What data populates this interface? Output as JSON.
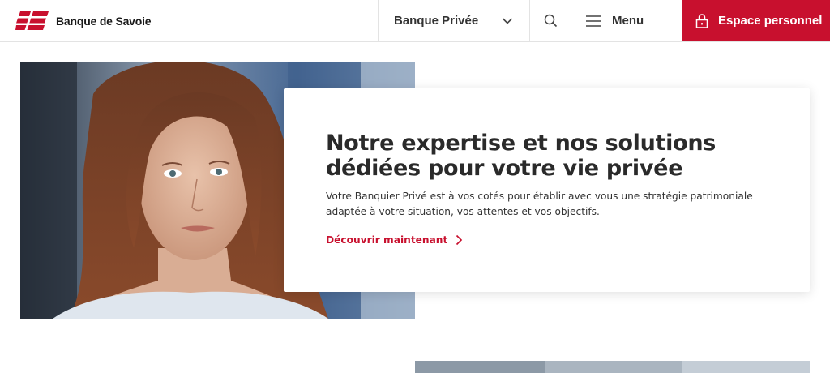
{
  "header": {
    "brand": "Banque de Savoie",
    "select_value": "Banque Privée",
    "menu_label": "Menu",
    "account_label": "Espace personnel"
  },
  "hero": {
    "title": "Notre expertise et nos solutions dédiées pour votre vie privée",
    "text": "Votre Banquier Privé est à vos cotés pour établir avec vous une stratégie patrimoniale adaptée à votre situation, vos attentes et vos objectifs.",
    "link_label": "Découvrir maintenant"
  },
  "colors": {
    "brand_red": "#c8102e",
    "text_dark": "#2a2a2a"
  },
  "icons": [
    "logo-mark",
    "chevron-down-icon",
    "search-icon",
    "hamburger-icon",
    "lock-icon",
    "chevron-right-icon"
  ]
}
